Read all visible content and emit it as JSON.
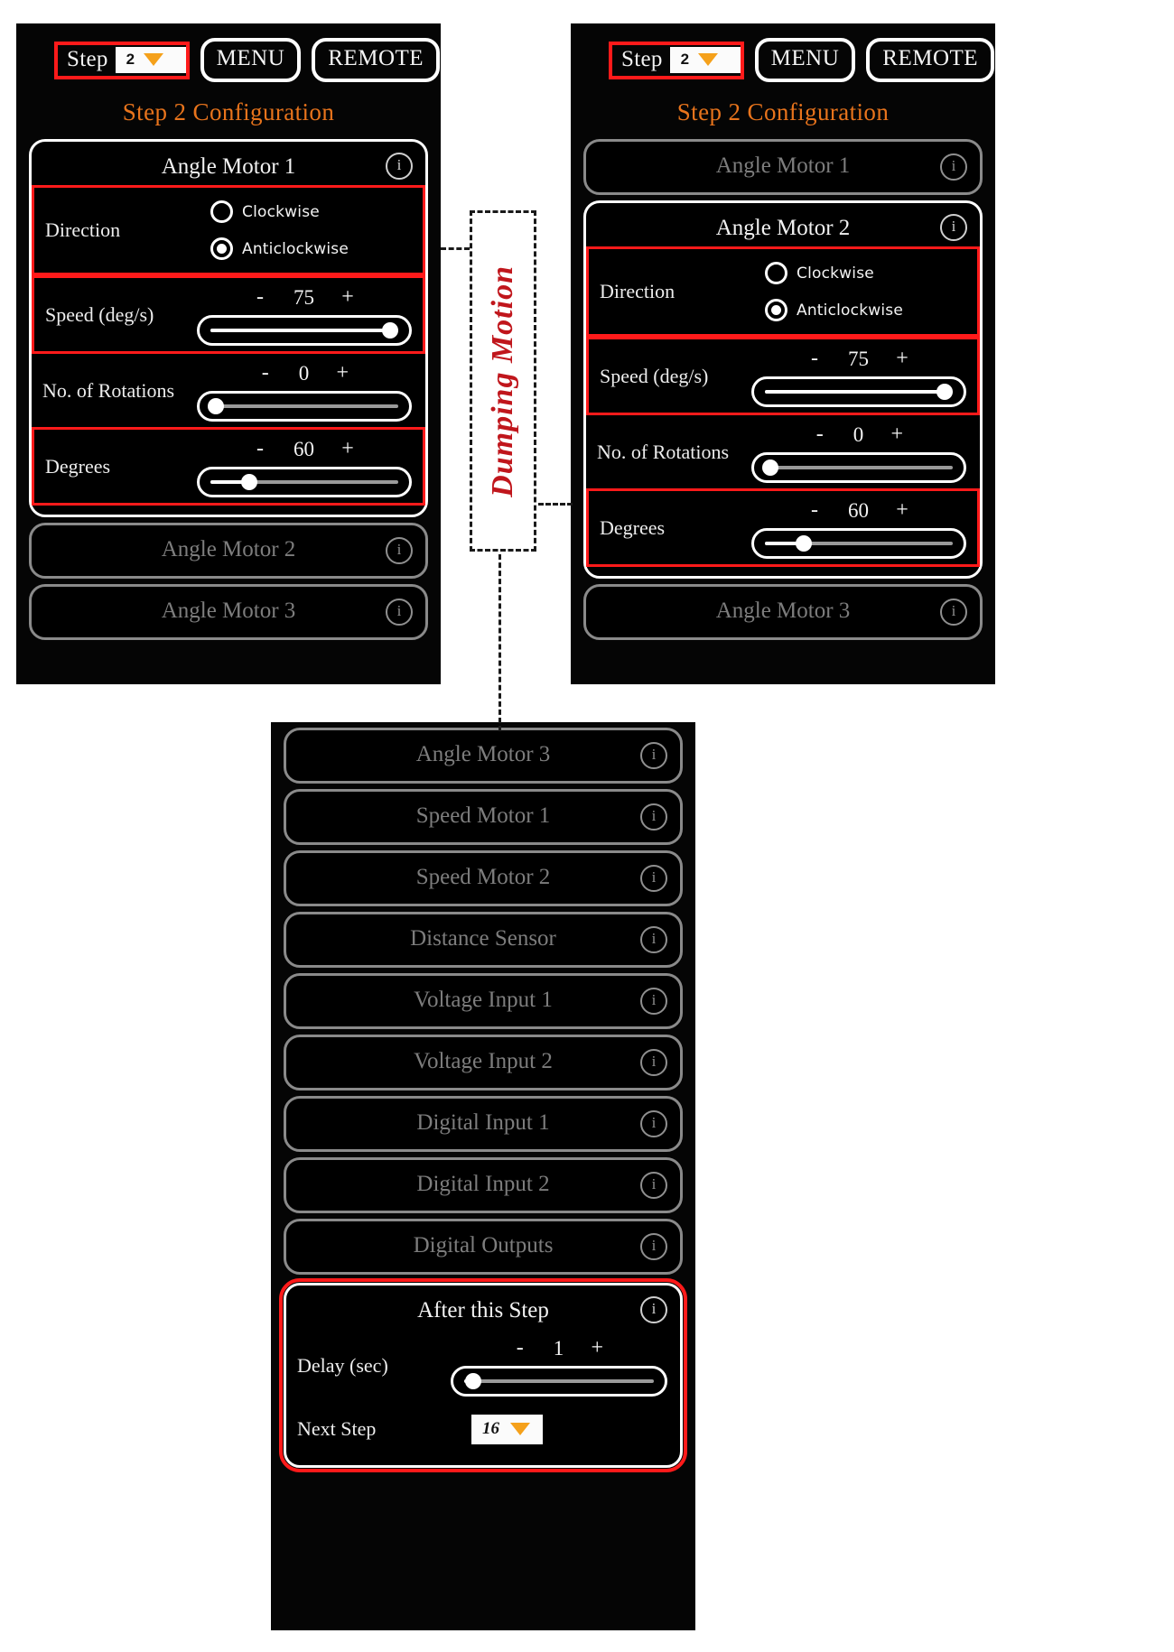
{
  "annotation": {
    "label": "Dumping Motion"
  },
  "topbar": {
    "step_label": "Step",
    "step_value": "2",
    "menu_label": "MENU",
    "remote_label": "REMOTE",
    "caret_icon": "chevron-down-icon"
  },
  "config_title": "Step 2 Configuration",
  "info_icon": "info-icon",
  "labels": {
    "direction": "Direction",
    "clockwise": "Clockwise",
    "anticlockwise": "Anticlockwise",
    "speed": "Speed (deg/s)",
    "rotations": "No. of Rotations",
    "degrees": "Degrees",
    "delay": "Delay (sec)",
    "next_step": "Next Step",
    "minus": "-",
    "plus": "+"
  },
  "panel1": {
    "expanded_card": "Angle Motor 1",
    "direction_selected": "anticlockwise",
    "speed_value": "75",
    "speed_percent": 96,
    "rotations_value": "0",
    "rotations_percent": 2,
    "degrees_value": "60",
    "degrees_percent": 21,
    "collapsed": [
      "Angle Motor 2",
      "Angle Motor 3"
    ]
  },
  "panel2": {
    "collapsed_top": [
      "Angle Motor 1"
    ],
    "expanded_card": "Angle Motor 2",
    "direction_selected": "anticlockwise",
    "speed_value": "75",
    "speed_percent": 96,
    "rotations_value": "0",
    "rotations_percent": 2,
    "degrees_value": "60",
    "degrees_percent": 21,
    "collapsed_bottom": [
      "Angle Motor 3"
    ]
  },
  "panel3": {
    "collapsed": [
      "Angle Motor 3",
      "Speed Motor 1",
      "Speed Motor 2",
      "Distance Sensor",
      "Voltage Input 1",
      "Voltage Input 2",
      "Digital Input 1",
      "Digital Input 2",
      "Digital Outputs"
    ],
    "after_step_title": "After this Step",
    "delay_value": "1",
    "delay_percent": 5,
    "next_step_value": "16"
  },
  "colors": {
    "highlight": "#ff1a1a",
    "accent_title": "#e8741c",
    "caret": "#f5a11b",
    "annotation_text": "#c0161c",
    "background": "#050505"
  }
}
